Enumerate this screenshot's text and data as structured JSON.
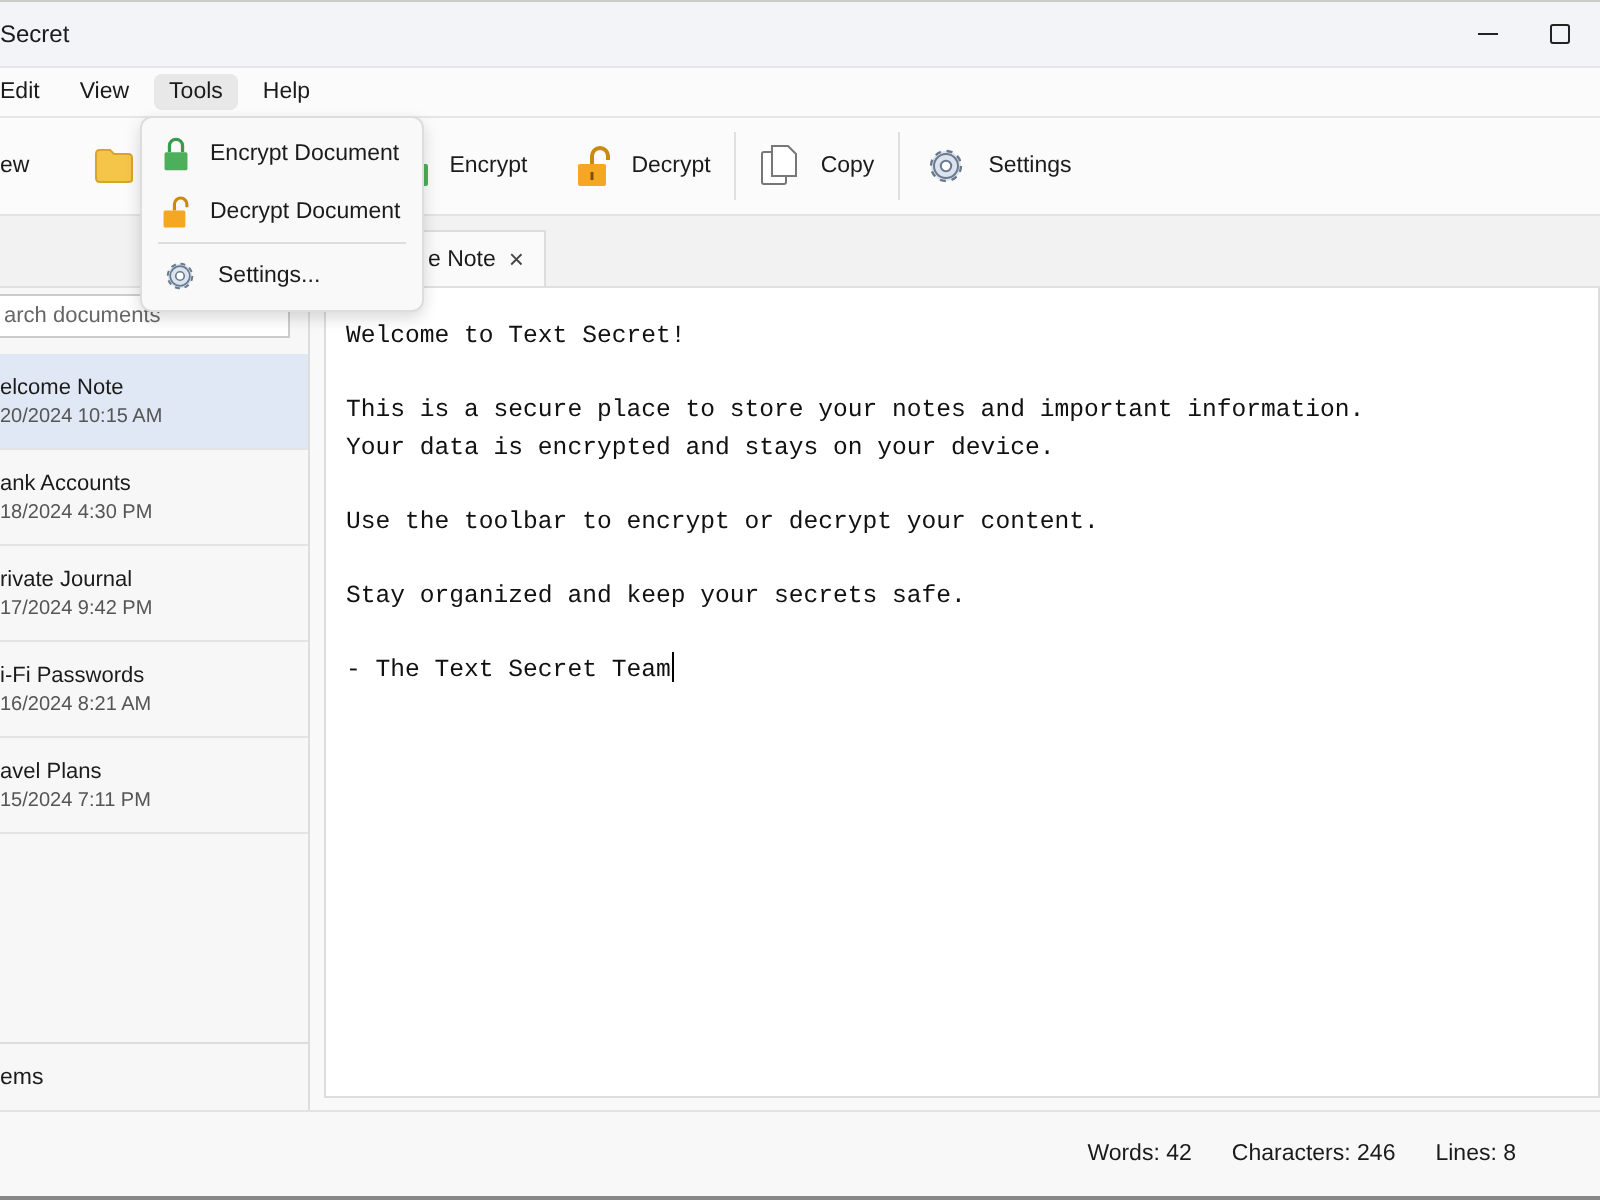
{
  "window": {
    "title": "Secret"
  },
  "menu": [
    {
      "label": "Edit",
      "selected": false
    },
    {
      "label": "View",
      "selected": false
    },
    {
      "label": "Tools",
      "selected": true
    },
    {
      "label": "Help",
      "selected": false
    }
  ],
  "toolbar": [
    {
      "kind": "none",
      "label": "ew",
      "sep": false
    },
    {
      "kind": "folder",
      "sep": false
    },
    {
      "kind": "lock-closed",
      "label": "Encrypt",
      "sep": false
    },
    {
      "kind": "lock-open",
      "label": "Decrypt",
      "sep": true
    },
    {
      "kind": "copy",
      "label": "Copy",
      "sep": true
    },
    {
      "kind": "gear",
      "label": "Settings",
      "sep": false
    }
  ],
  "dropdown": [
    {
      "kind": "lock-closed",
      "label": "Encrypt Document",
      "sep": false
    },
    {
      "kind": "lock-open",
      "label": "Decrypt Document",
      "sep": true
    },
    {
      "kind": "gear",
      "label": "Settings...",
      "sep": false
    }
  ],
  "search": {
    "placeholder": "arch documents"
  },
  "documents": [
    {
      "name": "elcome Note",
      "date": "20/2024 10:15 AM",
      "selected": true
    },
    {
      "name": "ank Accounts",
      "date": "18/2024 4:30 PM",
      "selected": false
    },
    {
      "name": "rivate Journal",
      "date": "17/2024 9:42 PM",
      "selected": false
    },
    {
      "name": "i-Fi Passwords",
      "date": "16/2024 8:21 AM",
      "selected": false
    },
    {
      "name": "avel Plans",
      "date": "15/2024 7:11 PM",
      "selected": false
    }
  ],
  "sidebar_footer": "ems",
  "tab": {
    "label": "e Note",
    "close": "×"
  },
  "editor": {
    "paragraphs": [
      [
        "Welcome to Text Secret!"
      ],
      [
        "This is a secure place to store your notes and important information.",
        "Your data is encrypted and stays on your device."
      ],
      [
        "Use the toolbar to encrypt or decrypt your content."
      ],
      [
        "Stay organized and keep your secrets safe."
      ],
      [
        "- The Text Secret Team"
      ]
    ]
  },
  "status_bar": [
    "Words: 42",
    "Characters: 246",
    "Lines: 8"
  ]
}
